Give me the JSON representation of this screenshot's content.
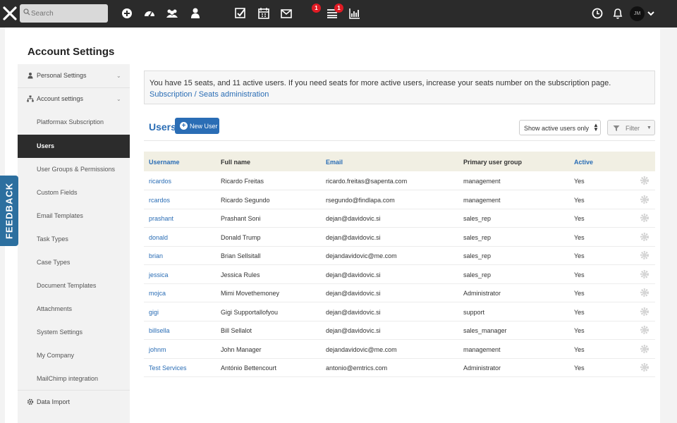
{
  "topbar": {
    "search_placeholder": "Search",
    "tasks_badge": "1",
    "list_badge": "1",
    "avatar_initials": "JM"
  },
  "page_title": "Account Settings",
  "sidebar": {
    "items": [
      {
        "label": "Personal Settings"
      },
      {
        "label": "Account settings"
      },
      {
        "label": "Platformax Subscription"
      },
      {
        "label": "Users"
      },
      {
        "label": "User Groups & Permissions"
      },
      {
        "label": "Custom Fields"
      },
      {
        "label": "Email Templates"
      },
      {
        "label": "Task Types"
      },
      {
        "label": "Case Types"
      },
      {
        "label": "Document Templates"
      },
      {
        "label": "Attachments"
      },
      {
        "label": "System Settings"
      },
      {
        "label": "My Company"
      },
      {
        "label": "MailChimp integration"
      },
      {
        "label": "Data Import"
      }
    ]
  },
  "feedback_label": "FEEDBACK",
  "info": {
    "message": "You have 15 seats, and 11 active users. If you need seats for more active users, increase your seats number on the subscription page.",
    "link": "Subscription / Seats administration"
  },
  "users": {
    "title": "Users",
    "new_user_label": "New User",
    "filter_select_value": "Show active users only",
    "filter_button_label": "Filter"
  },
  "table": {
    "columns": [
      "Username",
      "Full name",
      "Email",
      "Primary user group",
      "Active"
    ],
    "rows": [
      {
        "username": "ricardos",
        "full_name": "Ricardo Freitas",
        "email": "ricardo.freitas@sapenta.com",
        "group": "management",
        "active": "Yes"
      },
      {
        "username": "rcardos",
        "full_name": "Ricardo Segundo",
        "email": "rsegundo@findlapa.com",
        "group": "management",
        "active": "Yes"
      },
      {
        "username": "prashant",
        "full_name": "Prashant Soni",
        "email": "dejan@davidovic.si",
        "group": "sales_rep",
        "active": "Yes"
      },
      {
        "username": "donald",
        "full_name": "Donald Trump",
        "email": "dejan@davidovic.si",
        "group": "sales_rep",
        "active": "Yes"
      },
      {
        "username": "brian",
        "full_name": "Brian Sellsitall",
        "email": "dejandavidovic@me.com",
        "group": "sales_rep",
        "active": "Yes"
      },
      {
        "username": "jessica",
        "full_name": "Jessica Rules",
        "email": "dejan@davidovic.si",
        "group": "sales_rep",
        "active": "Yes"
      },
      {
        "username": "mojca",
        "full_name": "Mimi Movethemoney",
        "email": "dejan@davidovic.si",
        "group": "Administrator",
        "active": "Yes"
      },
      {
        "username": "gigi",
        "full_name": "Gigi Supportallofyou",
        "email": "dejan@davidovic.si",
        "group": "support",
        "active": "Yes"
      },
      {
        "username": "billsella",
        "full_name": "Bill Sellalot",
        "email": "dejan@davidovic.si",
        "group": "sales_manager",
        "active": "Yes"
      },
      {
        "username": "johnm",
        "full_name": "John Manager",
        "email": "dejandavidovic@me.com",
        "group": "management",
        "active": "Yes"
      },
      {
        "username": "Test Services",
        "full_name": "António Bettencourt",
        "email": "antonio@emtrics.com",
        "group": "Administrator",
        "active": "Yes"
      }
    ]
  }
}
